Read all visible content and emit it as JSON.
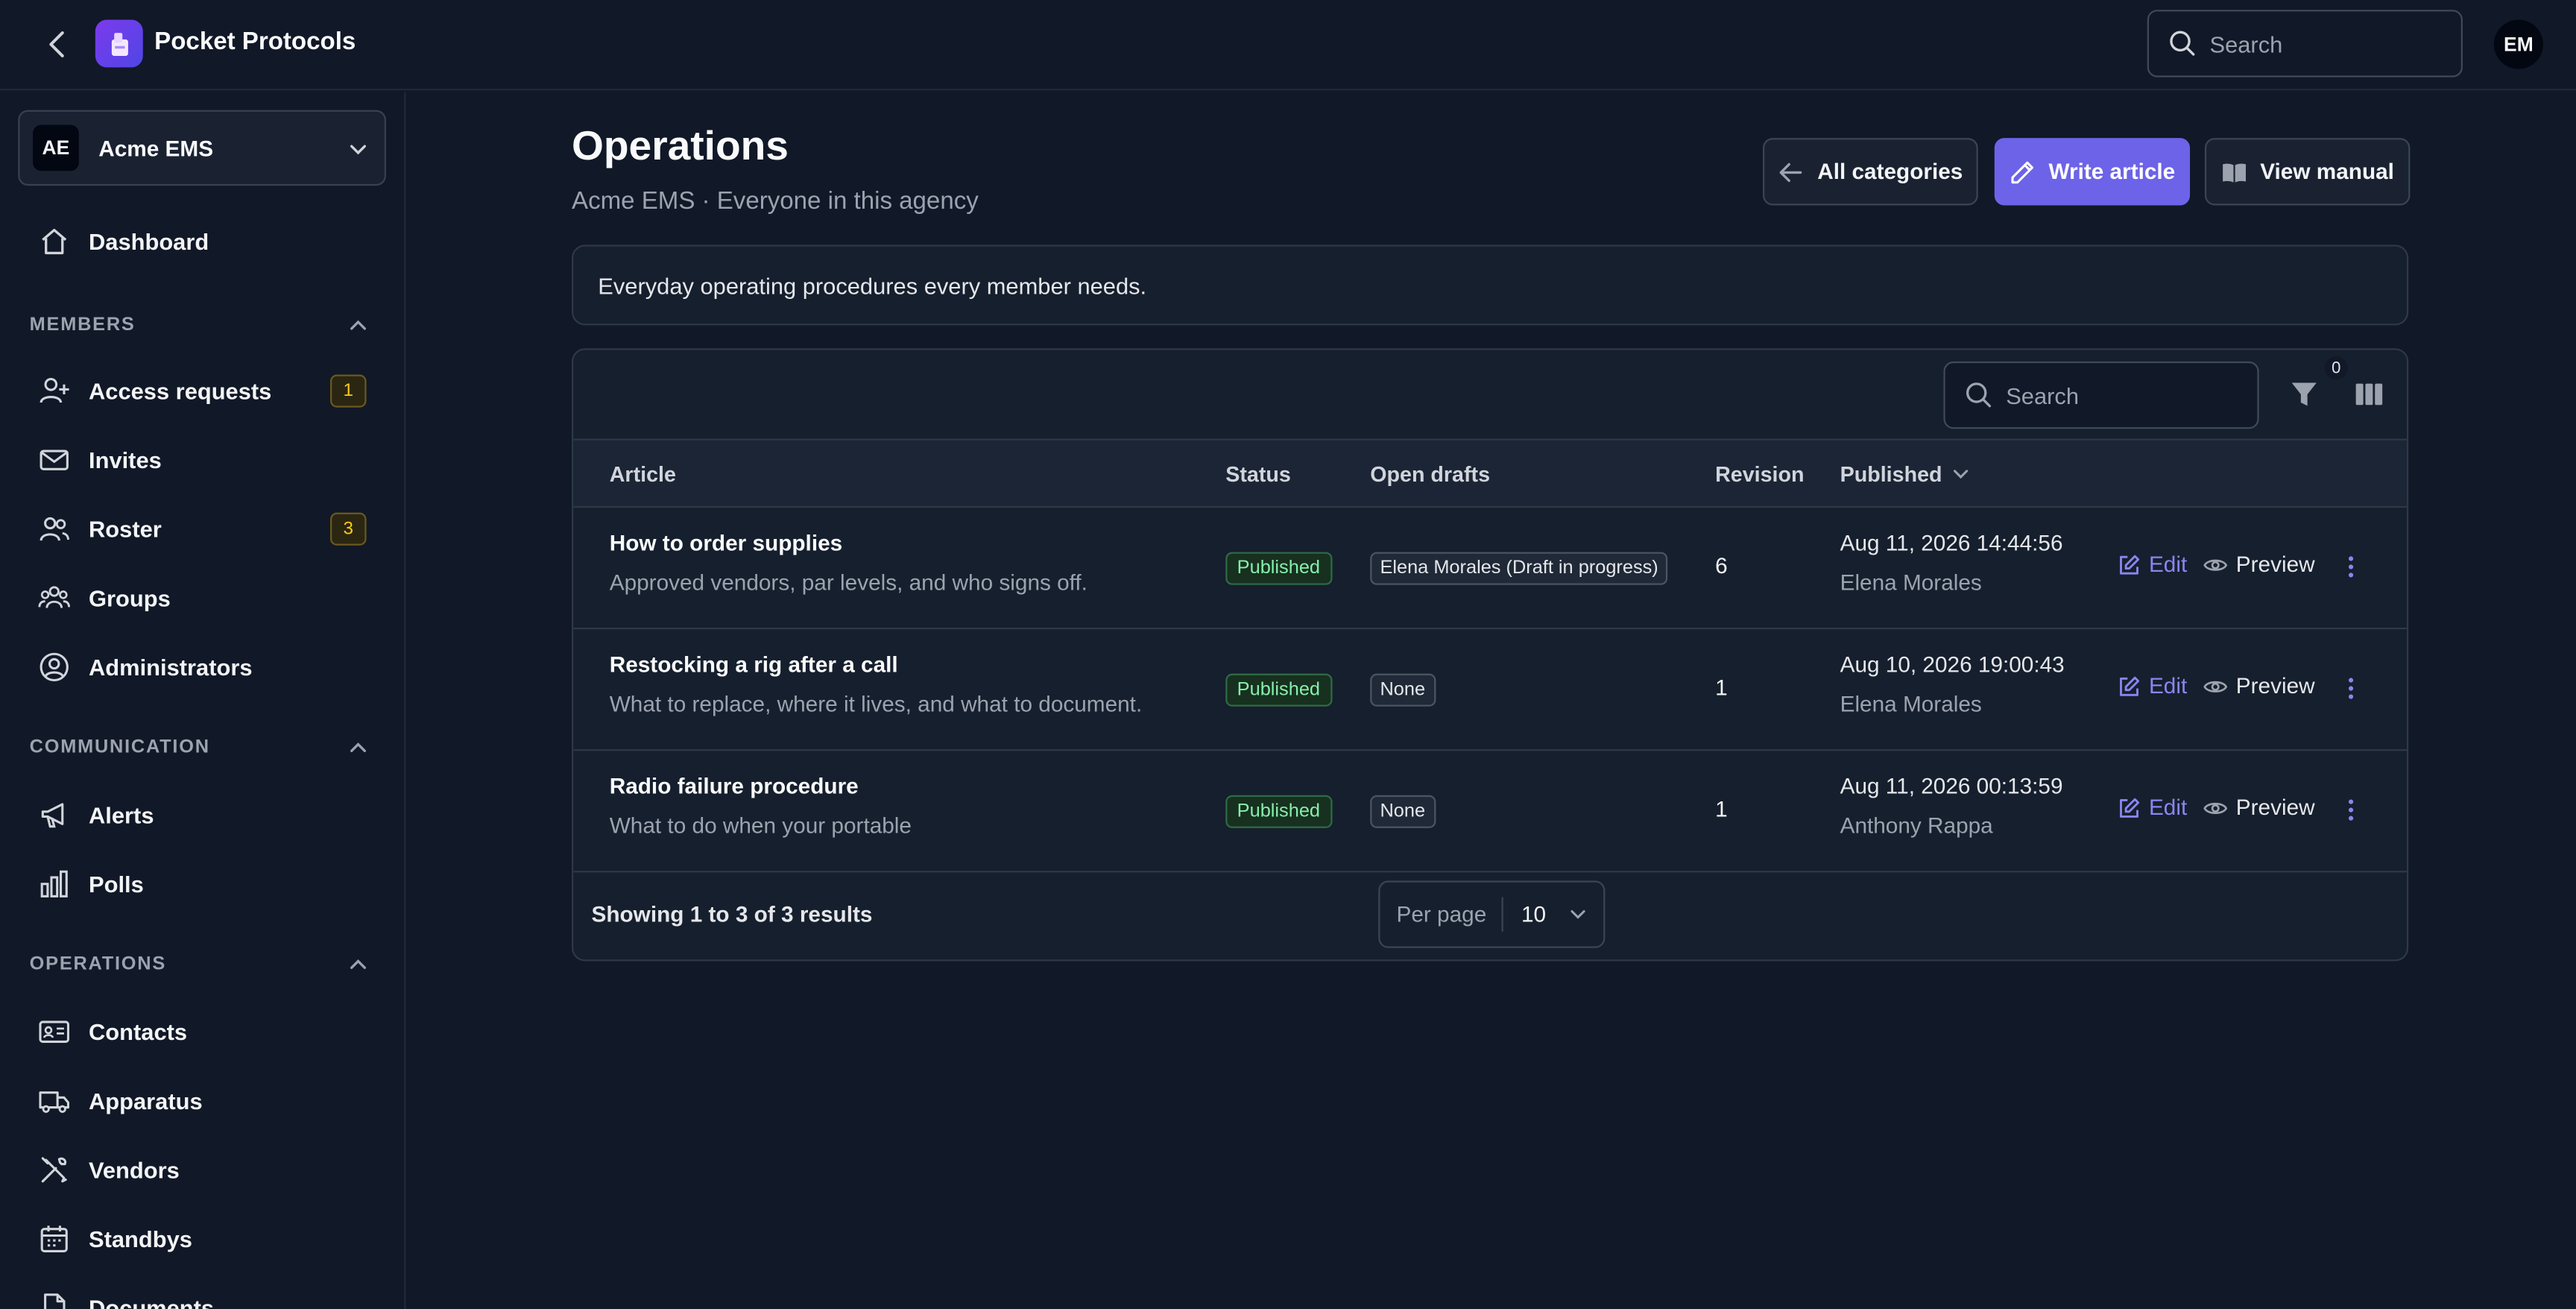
{
  "app": {
    "title": "Pocket Protocols"
  },
  "topbar": {
    "search_placeholder": "Search",
    "user_initials": "EM"
  },
  "org": {
    "initials": "AE",
    "name": "Acme EMS"
  },
  "sidebar": {
    "dashboard": "Dashboard",
    "sections": [
      {
        "title": "MEMBERS",
        "items": [
          {
            "label": "Access requests",
            "icon": "user-plus-icon",
            "badge": "1"
          },
          {
            "label": "Invites",
            "icon": "envelope-icon",
            "badge": ""
          },
          {
            "label": "Roster",
            "icon": "users-icon",
            "badge": "3"
          },
          {
            "label": "Groups",
            "icon": "user-group-icon",
            "badge": ""
          },
          {
            "label": "Administrators",
            "icon": "user-circle-icon",
            "badge": ""
          }
        ]
      },
      {
        "title": "COMMUNICATION",
        "items": [
          {
            "label": "Alerts",
            "icon": "megaphone-icon",
            "badge": ""
          },
          {
            "label": "Polls",
            "icon": "chart-bar-icon",
            "badge": ""
          }
        ]
      },
      {
        "title": "OPERATIONS",
        "items": [
          {
            "label": "Contacts",
            "icon": "identification-icon",
            "badge": ""
          },
          {
            "label": "Apparatus",
            "icon": "truck-icon",
            "badge": ""
          },
          {
            "label": "Vendors",
            "icon": "wrench-screwdriver-icon",
            "badge": ""
          },
          {
            "label": "Standbys",
            "icon": "calendar-icon",
            "badge": ""
          },
          {
            "label": "Documents",
            "icon": "document-icon",
            "badge": ""
          }
        ]
      }
    ]
  },
  "main": {
    "title": "Operations",
    "subtitle": "Acme EMS · Everyone in this agency",
    "buttons": {
      "all_categories": "All categories",
      "write_article": "Write article",
      "view_manual": "View manual"
    },
    "description": "Everyday operating procedures every member needs."
  },
  "table": {
    "search_placeholder": "Search",
    "filter_count": "0",
    "columns": [
      "Article",
      "Status",
      "Open drafts",
      "Revision",
      "Published"
    ],
    "rows": [
      {
        "title": "How to order supplies",
        "desc": "Approved vendors, par levels, and who signs off.",
        "status": "Published",
        "drafts": "Elena Morales (Draft in progress)",
        "revision": "6",
        "published": "Aug 11, 2026 14:44:56",
        "by": "Elena Morales"
      },
      {
        "title": "Restocking a rig after a call",
        "desc": "What to replace, where it lives, and what to document.",
        "status": "Published",
        "drafts": "None",
        "revision": "1",
        "published": "Aug 10, 2026 19:00:43",
        "by": "Elena Morales"
      },
      {
        "title": "Radio failure procedure",
        "desc": "What to do when your portable",
        "status": "Published",
        "drafts": "None",
        "revision": "1",
        "published": "Aug 11, 2026 00:13:59",
        "by": "Anthony Rappa"
      }
    ],
    "actions": {
      "edit": "Edit",
      "preview": "Preview"
    },
    "footer": {
      "showing": "Showing 1 to 3 of 3 results",
      "per_page_label": "Per page",
      "per_page_value": "10"
    }
  },
  "colors": {
    "accent": "#6d63e8",
    "background": "#111827",
    "success": "#86efac",
    "warning": "#facc15"
  }
}
